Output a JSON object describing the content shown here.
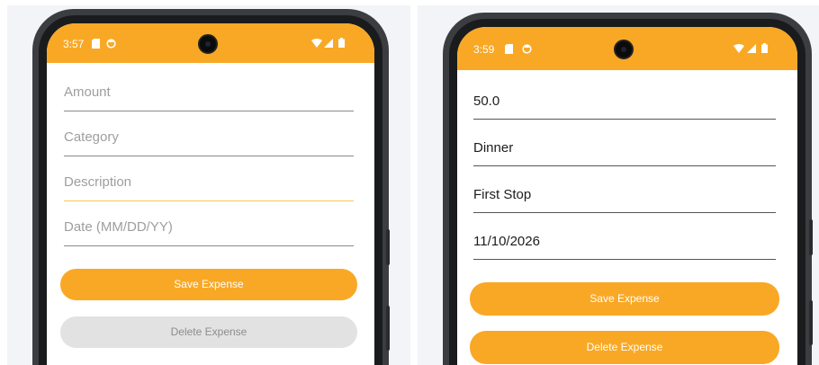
{
  "colors": {
    "accent": "#f9a825",
    "disabled_button": "#e2e2e2",
    "disabled_text": "#8d8d8d",
    "focused_underline": "#f9c65a"
  },
  "left_screen": {
    "status_bar": {
      "time": "3:57",
      "icons": [
        "sim-card-icon",
        "sync-icon",
        "wifi-icon",
        "cell-signal-icon",
        "battery-icon"
      ]
    },
    "form": {
      "amount_placeholder": "Amount",
      "category_placeholder": "Category",
      "description_placeholder": "Description",
      "date_placeholder": "Date (MM/DD/YY)",
      "description_focused": true
    },
    "buttons": {
      "save_label": "Save Expense",
      "delete_label": "Delete Expense",
      "delete_enabled": false
    }
  },
  "right_screen": {
    "status_bar": {
      "time": "3:59",
      "icons": [
        "sim-card-icon",
        "sync-icon",
        "wifi-icon",
        "cell-signal-icon",
        "battery-icon"
      ]
    },
    "form": {
      "amount_value": "50.0",
      "category_value": "Dinner",
      "description_value": "First Stop",
      "date_value": "11/10/2026"
    },
    "buttons": {
      "save_label": "Save Expense",
      "delete_label": "Delete Expense",
      "delete_enabled": true
    }
  }
}
